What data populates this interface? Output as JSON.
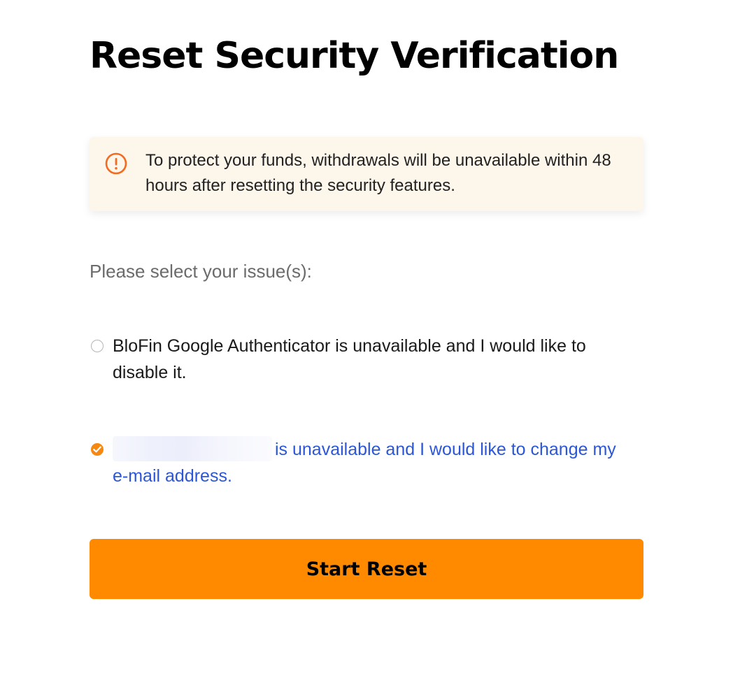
{
  "page": {
    "title": "Reset Security Verification"
  },
  "notice": {
    "icon": "exclamation-circle-icon",
    "text": "To protect your funds, withdrawals will be unavailable within 48 hours after resetting the security features.",
    "background_color": "#fdf6ea",
    "icon_color": "#f36b21"
  },
  "issues": {
    "label": "Please select your issue(s):",
    "options": [
      {
        "text": "BloFin Google Authenticator is unavailable and I would like to disable it.",
        "checked": false
      },
      {
        "text": "is unavailable and I would like to change my e-mail address.",
        "checked": true,
        "prefix_redacted": true
      }
    ],
    "selected_color": "#2c56d8",
    "check_color": "#f7880f"
  },
  "actions": {
    "start_reset_label": "Start Reset",
    "button_color": "#ff8a00"
  }
}
